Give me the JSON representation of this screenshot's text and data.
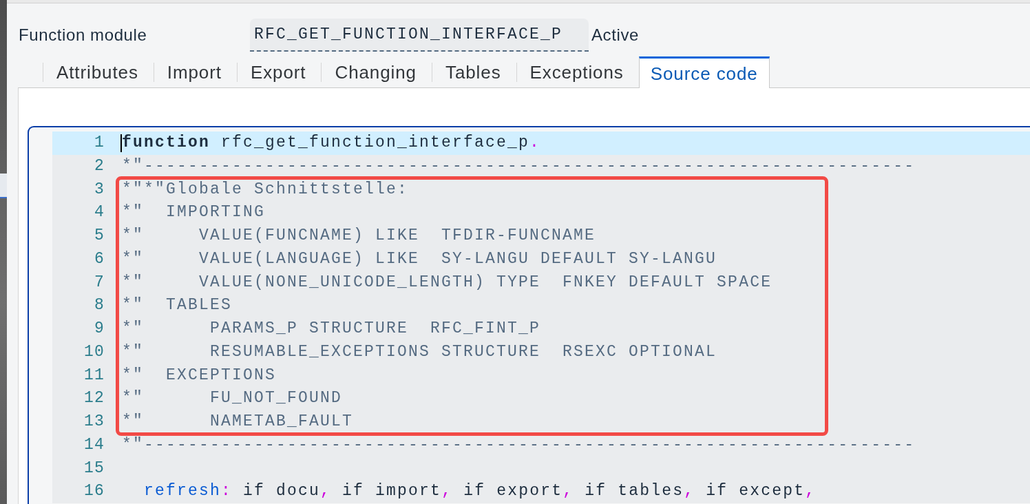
{
  "header": {
    "label": "Function module",
    "field_value": "RFC_GET_FUNCTION_INTERFACE_P",
    "status": "Active"
  },
  "tabs": [
    {
      "label": "Attributes",
      "selected": false
    },
    {
      "label": "Import",
      "selected": false
    },
    {
      "label": "Export",
      "selected": false
    },
    {
      "label": "Changing",
      "selected": false
    },
    {
      "label": "Tables",
      "selected": false
    },
    {
      "label": "Exceptions",
      "selected": false
    },
    {
      "label": "Source code",
      "selected": true
    }
  ],
  "editor": {
    "blocks": [
      {
        "kind": "plain",
        "lines": [
          {
            "number": "1",
            "current": true,
            "tokens": [
              {
                "kind": "keyword",
                "text": "function"
              },
              {
                "kind": "plain",
                "text": " rfc_get_function_interface_p"
              },
              {
                "kind": "punct",
                "text": "."
              }
            ]
          },
          {
            "number": "2",
            "current": false,
            "tokens": [
              {
                "kind": "comment",
                "text": "*\"----------------------------------------------------------------------"
              }
            ]
          }
        ]
      },
      {
        "kind": "framed",
        "lines": [
          {
            "number": "3",
            "current": false,
            "tokens": [
              {
                "kind": "comment",
                "text": "*\"*\"Globale Schnittstelle:"
              }
            ]
          },
          {
            "number": "4",
            "current": false,
            "tokens": [
              {
                "kind": "comment",
                "text": "*\"  IMPORTING"
              }
            ]
          },
          {
            "number": "5",
            "current": false,
            "tokens": [
              {
                "kind": "comment",
                "text": "*\"     VALUE(FUNCNAME) LIKE  TFDIR-FUNCNAME"
              }
            ]
          },
          {
            "number": "6",
            "current": false,
            "tokens": [
              {
                "kind": "comment",
                "text": "*\"     VALUE(LANGUAGE) LIKE  SY-LANGU DEFAULT SY-LANGU"
              }
            ]
          },
          {
            "number": "7",
            "current": false,
            "tokens": [
              {
                "kind": "comment",
                "text": "*\"     VALUE(NONE_UNICODE_LENGTH) TYPE  FNKEY DEFAULT SPACE"
              }
            ]
          },
          {
            "number": "8",
            "current": false,
            "tokens": [
              {
                "kind": "comment",
                "text": "*\"  TABLES"
              }
            ]
          },
          {
            "number": "9",
            "current": false,
            "tokens": [
              {
                "kind": "comment",
                "text": "*\"      PARAMS_P STRUCTURE  RFC_FINT_P"
              }
            ]
          },
          {
            "number": "10",
            "current": false,
            "tokens": [
              {
                "kind": "comment",
                "text": "*\"      RESUMABLE_EXCEPTIONS STRUCTURE  RSEXC OPTIONAL"
              }
            ]
          },
          {
            "number": "11",
            "current": false,
            "tokens": [
              {
                "kind": "comment",
                "text": "*\"  EXCEPTIONS"
              }
            ]
          },
          {
            "number": "12",
            "current": false,
            "tokens": [
              {
                "kind": "comment",
                "text": "*\"      FU_NOT_FOUND"
              }
            ]
          },
          {
            "number": "13",
            "current": false,
            "tokens": [
              {
                "kind": "comment",
                "text": "*\"      NAMETAB_FAULT"
              }
            ]
          }
        ]
      },
      {
        "kind": "plain",
        "lines": [
          {
            "number": "14",
            "current": false,
            "tokens": [
              {
                "kind": "comment",
                "text": "*\"----------------------------------------------------------------------"
              }
            ]
          },
          {
            "number": "15",
            "current": false
          },
          {
            "number": "16",
            "current": false,
            "tokens": [
              {
                "kind": "label",
                "text": "  refresh"
              },
              {
                "kind": "punct",
                "text": ":"
              },
              {
                "kind": "plain",
                "text": " if docu"
              },
              {
                "kind": "punct",
                "text": ","
              },
              {
                "kind": "plain",
                "text": " if import"
              },
              {
                "kind": "punct",
                "text": ","
              },
              {
                "kind": "plain",
                "text": " if export"
              },
              {
                "kind": "punct",
                "text": ","
              },
              {
                "kind": "plain",
                "text": " if tables"
              },
              {
                "kind": "punct",
                "text": ","
              },
              {
                "kind": "plain",
                "text": " if except"
              },
              {
                "kind": "punct",
                "text": ","
              }
            ]
          }
        ]
      }
    ]
  }
}
